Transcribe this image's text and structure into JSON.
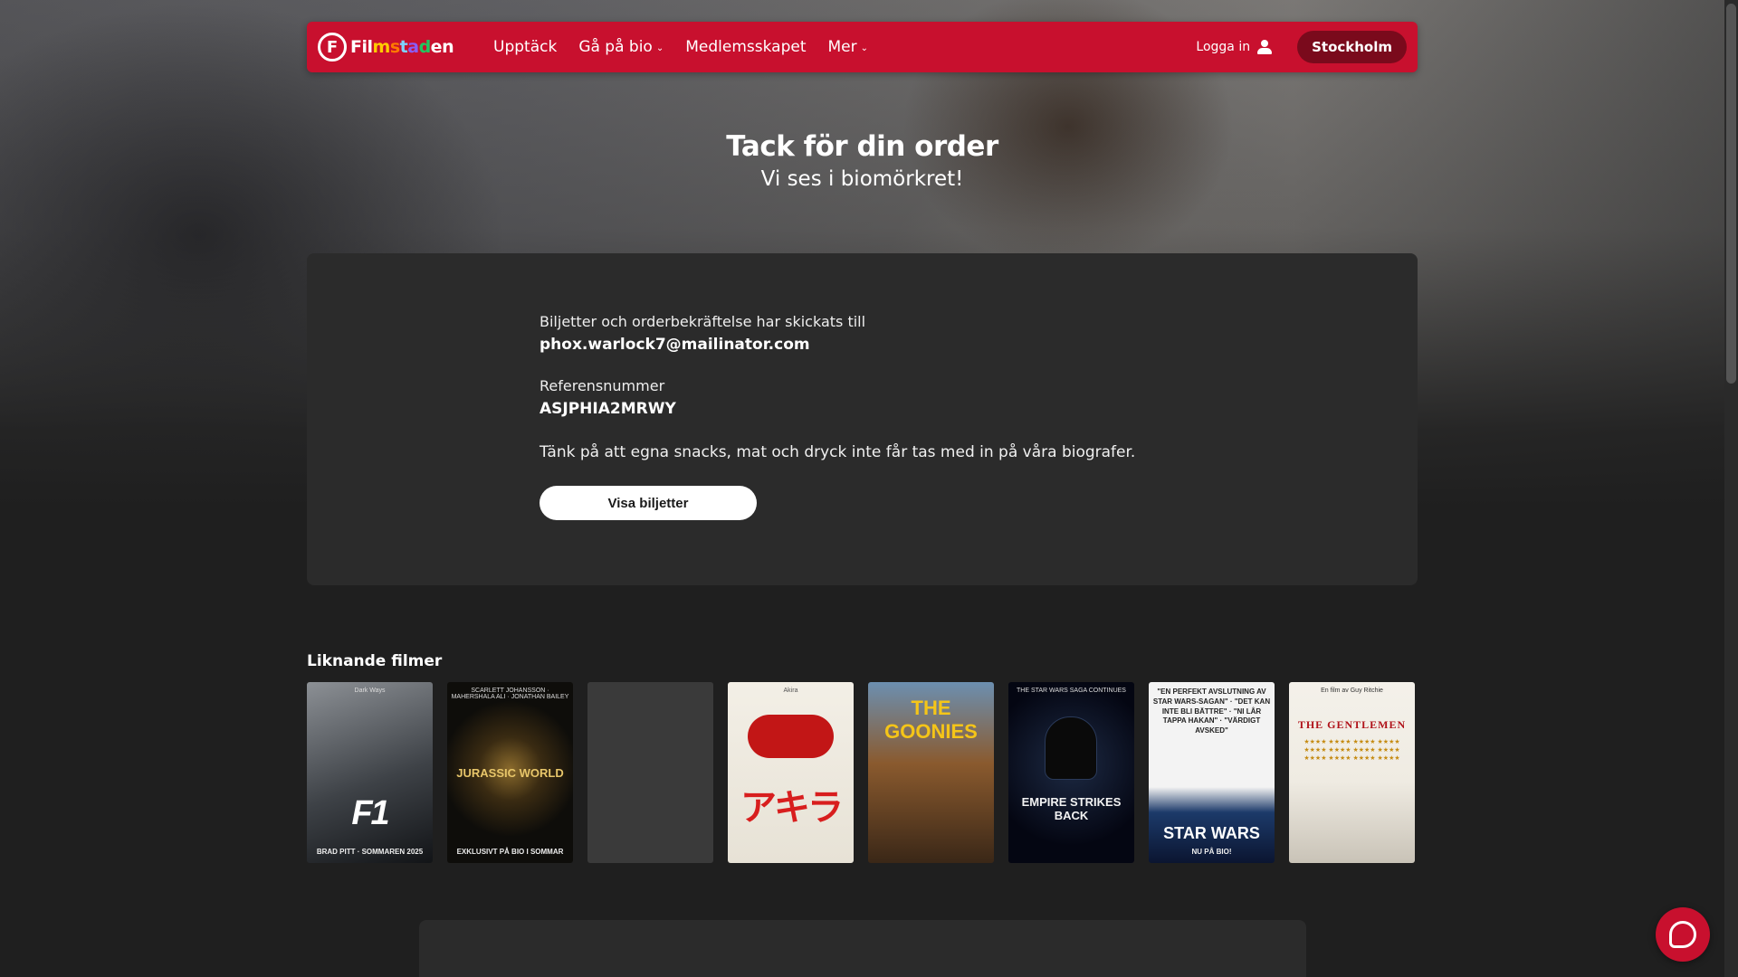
{
  "header": {
    "logo_letter": "F",
    "logo_text": [
      "F",
      "i",
      "l",
      "m",
      "s",
      "t",
      "a",
      "d",
      "e",
      "n"
    ],
    "nav": {
      "upptack": "Upptäck",
      "ga_pa_bio": "Gå på bio",
      "medlemsskapet": "Medlemsskapet",
      "mer": "Mer"
    },
    "login": "Logga in",
    "city": "Stockholm"
  },
  "hero": {
    "title": "Tack för din order",
    "subtitle": "Vi ses i biomörkret!"
  },
  "order": {
    "sent_label": "Biljetter och orderbekräftelse har skickats till",
    "email": "phox.warlock7@mailinator.com",
    "ref_label": "Referensnummer",
    "ref_number": "ASJPHIA2MRWY",
    "notice": "Tänk på att egna snacks, mat och dryck inte får tas med in på våra biografer.",
    "tickets_button": "Visa biljetter"
  },
  "similar": {
    "heading": "Liknande filmer",
    "posters": {
      "f1": {
        "top": "Dark Ways",
        "main": "F1",
        "bottom": "BRAD PITT · SOMMAREN 2025"
      },
      "jw": {
        "top": "SCARLETT JOHANSSON · MAHERSHALA ALI · JONATHAN BAILEY",
        "main": "JURASSIC WORLD",
        "bottom": "EXKLUSIVT PÅ BIO I SOMMAR"
      },
      "akira": {
        "top": "Akira",
        "main": "アキラ",
        "bottom": ""
      },
      "goonies": {
        "top": "",
        "main": "THE GOONIES",
        "bottom": ""
      },
      "esb": {
        "top": "THE STAR WARS SAGA CONTINUES",
        "main": "EMPIRE STRIKES BACK",
        "bottom": ""
      },
      "sw": {
        "top": "\"EN PERFEKT AVSLUTNING AV STAR WARS-SAGAN\" · \"DET KAN INTE BLI BÄTTRE\" · \"NI LÅR TAPPA HAKAN\" · \"VÄRDIGT AVSKED\"",
        "main": "STAR WARS",
        "bottom": "NU PÅ BIO!"
      },
      "gent": {
        "top": "En film av Guy Ritchie",
        "main": "THE GENTLEMEN",
        "stars": "★★★★ ★★★★ ★★★★ ★★★★ ★★★★ ★★★★ ★★★★ ★★★★ ★★★★ ★★★★ ★★★★ ★★★★"
      }
    }
  },
  "colors": {
    "brand_red": "#c8102e",
    "panel": "#2b2b2b",
    "background": "#1f1f1f"
  },
  "icons": {
    "user": "user-icon",
    "chevron": "chevron-down-icon",
    "chat": "chat-icon"
  }
}
